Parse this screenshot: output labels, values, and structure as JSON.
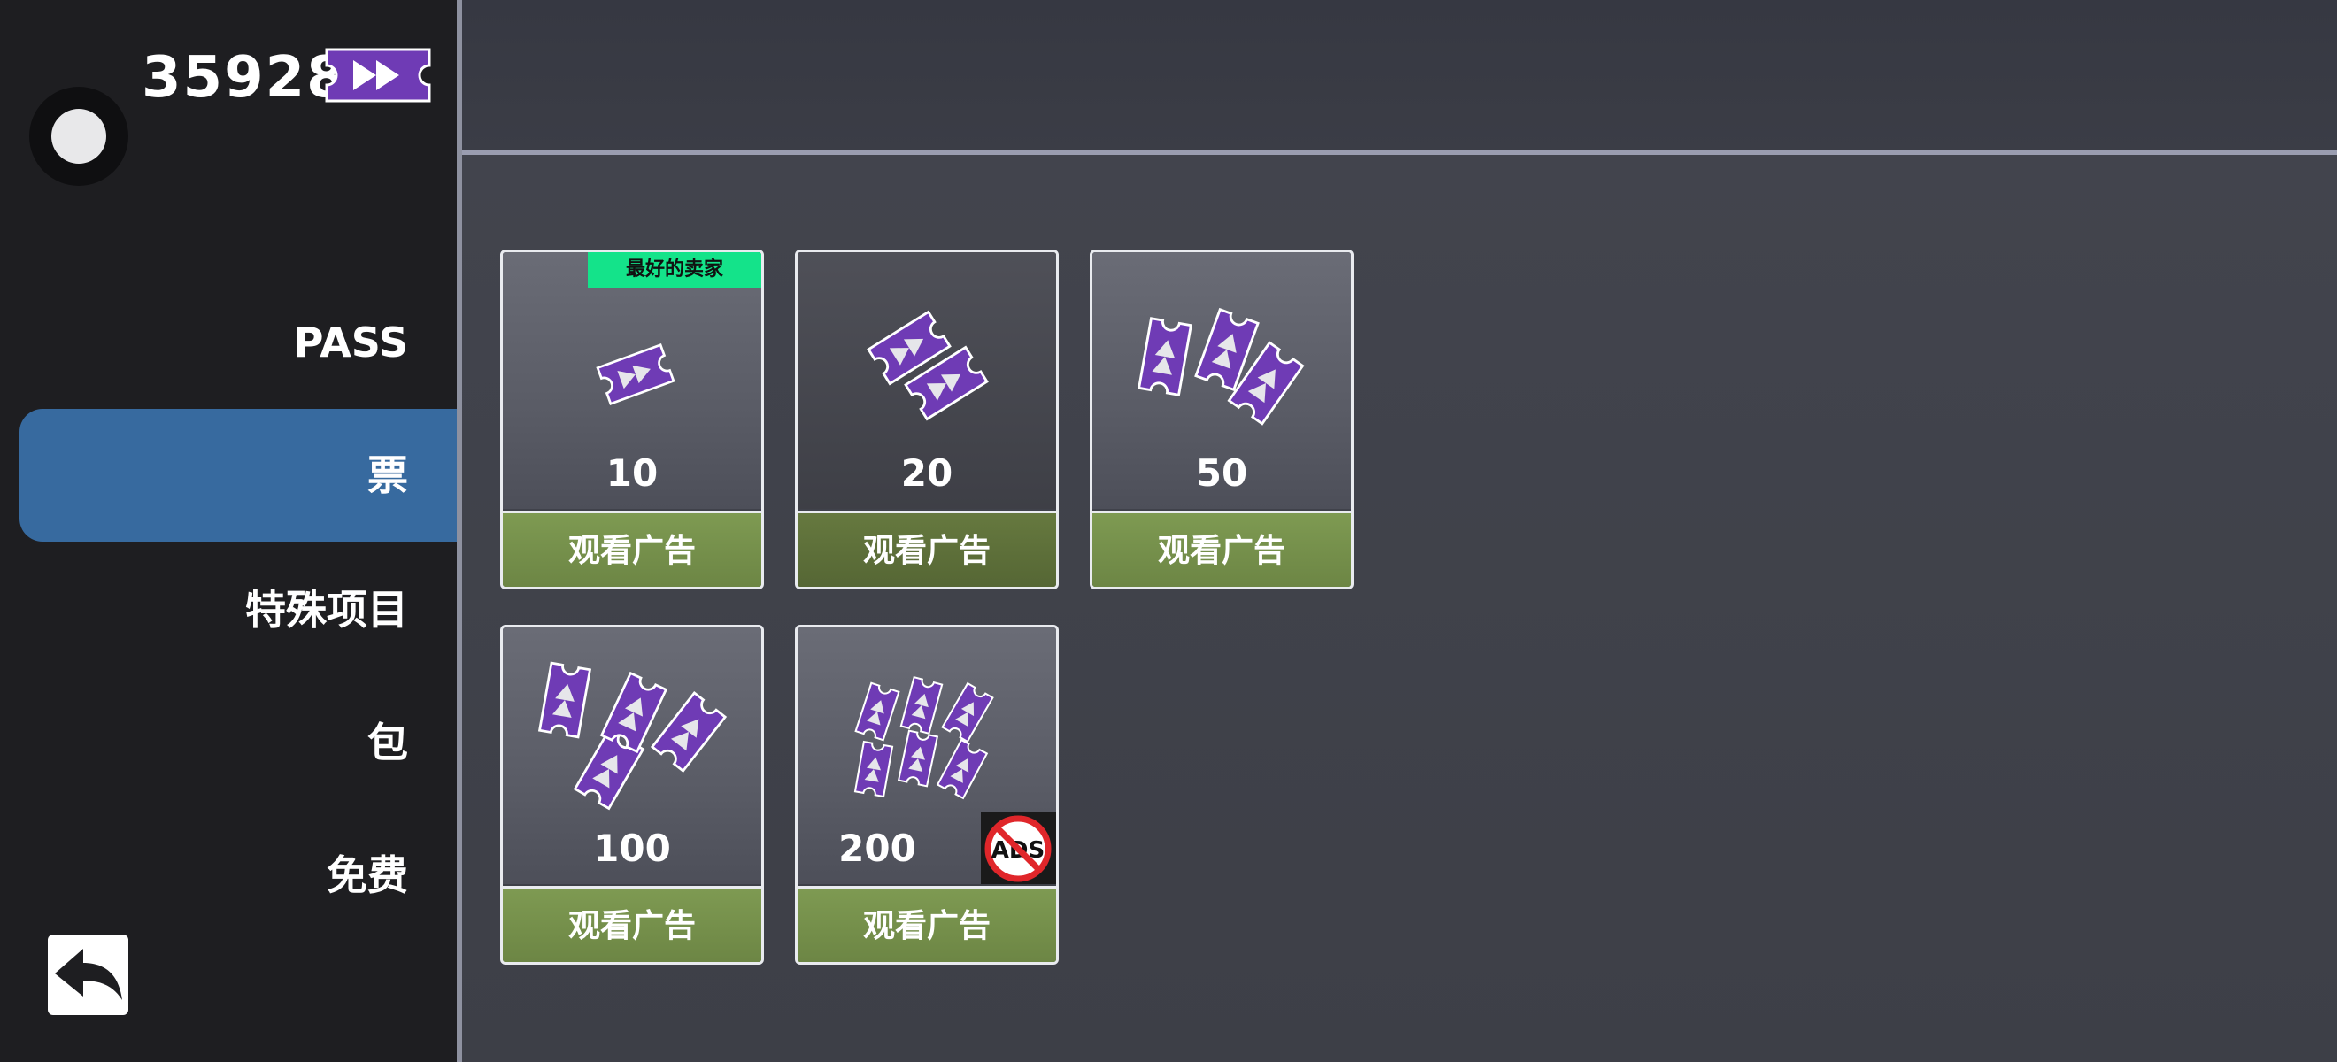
{
  "header": {
    "currency_amount": "35928",
    "currency_icon": "ticket-fast-forward-icon"
  },
  "sidebar": {
    "items": [
      {
        "label": "PASS",
        "active": false
      },
      {
        "label": "票",
        "active": true
      },
      {
        "label": "特殊项目",
        "active": false
      },
      {
        "label": "包",
        "active": false
      },
      {
        "label": "免费",
        "active": false
      }
    ],
    "back_icon": "back-arrow-icon"
  },
  "shop": {
    "items": [
      {
        "amount": "10",
        "button": "观看广告",
        "badge": "最好的卖家"
      },
      {
        "amount": "20",
        "button": "观看广告"
      },
      {
        "amount": "50",
        "button": "观看广告"
      },
      {
        "amount": "100",
        "button": "观看广告"
      },
      {
        "amount": "200",
        "button": "观看广告",
        "no_ads_icon": "no-ads-icon"
      }
    ]
  },
  "colors": {
    "accent_active": "#376a9f",
    "ticket_purple": "#6f3bb5",
    "badge_green": "#14e38a",
    "button_green": "#7e9a52"
  }
}
